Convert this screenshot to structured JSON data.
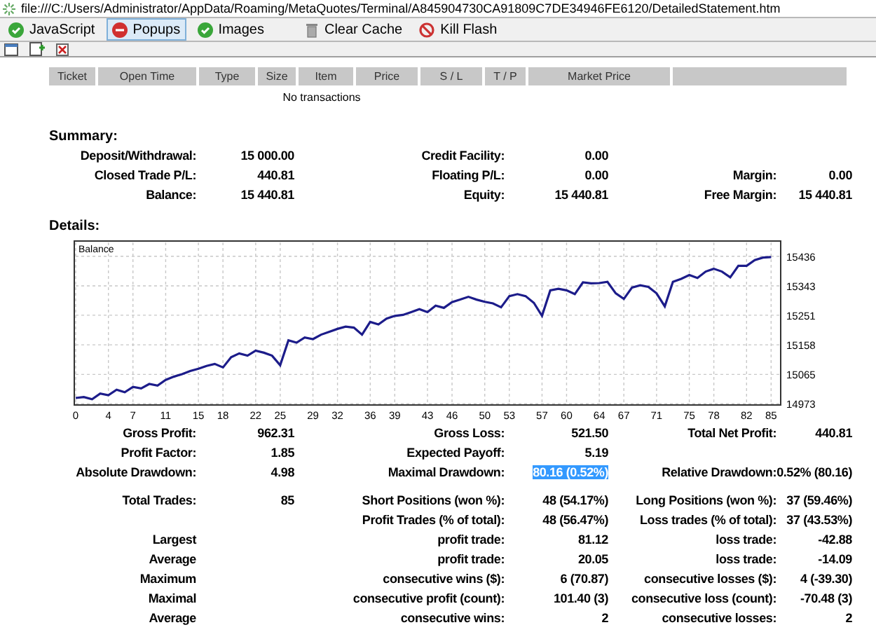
{
  "address_bar": {
    "url": "file:///C:/Users/Administrator/AppData/Roaming/MetaQuotes/Terminal/A845904730CA91809C7DE34946FE6120/DetailedStatement.htm"
  },
  "toolbar": [
    {
      "label": "JavaScript",
      "kind": "allowed",
      "selected": false
    },
    {
      "label": "Popups",
      "kind": "blocked",
      "selected": true
    },
    {
      "label": "Images",
      "kind": "allowed",
      "selected": false
    },
    {
      "label": "Clear Cache",
      "kind": "trash",
      "selected": false
    },
    {
      "label": "Kill Flash",
      "kind": "flash",
      "selected": false
    }
  ],
  "working_orders": {
    "columns": [
      "Ticket",
      "Open Time",
      "Type",
      "Size",
      "Item",
      "Price",
      "S / L",
      "T / P",
      "Market Price"
    ],
    "empty_text": "No transactions"
  },
  "summary": {
    "title": "Summary:",
    "groups": [
      [
        {
          "left": {
            "label": "Deposit/Withdrawal:",
            "value": "15 000.00"
          },
          "middle": {
            "label": "Credit Facility:",
            "value": "0.00"
          }
        },
        {
          "left": {
            "label": "Closed Trade P/L:",
            "value": "440.81"
          },
          "middle": {
            "label": "Floating P/L:",
            "value": "0.00"
          },
          "right": {
            "label": "Margin:",
            "value": "0.00"
          }
        },
        {
          "left": {
            "label": "Balance:",
            "value": "15 440.81"
          },
          "middle": {
            "label": "Equity:",
            "value": "15 440.81"
          },
          "right": {
            "label": "Free Margin:",
            "value": "15 440.81"
          }
        }
      ]
    ]
  },
  "details": {
    "title": "Details:",
    "chart_data": {
      "type": "line",
      "grid": true,
      "x": [
        0,
        1,
        2,
        3,
        4,
        5,
        6,
        7,
        8,
        9,
        10,
        11,
        12,
        13,
        14,
        15,
        16,
        17,
        18,
        19,
        20,
        21,
        22,
        23,
        24,
        25,
        26,
        27,
        28,
        29,
        30,
        31,
        32,
        33,
        34,
        35,
        36,
        37,
        38,
        39,
        40,
        41,
        42,
        43,
        44,
        45,
        46,
        47,
        48,
        49,
        50,
        51,
        52,
        53,
        54,
        55,
        56,
        57,
        58,
        59,
        60,
        61,
        62,
        63,
        64,
        65,
        66,
        67,
        68,
        69,
        70,
        71,
        72,
        73,
        74,
        75,
        76,
        77,
        78,
        79,
        80,
        81,
        82,
        83,
        84,
        85
      ],
      "series": [
        {
          "name": "Balance",
          "color": "#1c1c8a",
          "values": [
            14991,
            14994,
            14987,
            15005,
            15000,
            15017,
            15009,
            15026,
            15021,
            15035,
            15030,
            15048,
            15058,
            15066,
            15076,
            15083,
            15092,
            15098,
            15087,
            15119,
            15131,
            15124,
            15140,
            15133,
            15124,
            15094,
            15172,
            15165,
            15181,
            15176,
            15190,
            15199,
            15208,
            15215,
            15212,
            15190,
            15230,
            15222,
            15240,
            15249,
            15252,
            15261,
            15270,
            15261,
            15281,
            15274,
            15292,
            15300,
            15309,
            15300,
            15293,
            15288,
            15276,
            15311,
            15317,
            15311,
            15290,
            15249,
            15329,
            15334,
            15329,
            15317,
            15354,
            15351,
            15352,
            15356,
            15320,
            15302,
            15338,
            15345,
            15340,
            15320,
            15279,
            15356,
            15365,
            15377,
            15368,
            15388,
            15397,
            15388,
            15370,
            15406,
            15406,
            15424,
            15432,
            15434
          ]
        }
      ],
      "xlim": [
        0,
        86
      ],
      "ylim": [
        14969,
        15484
      ],
      "xticks": [
        0,
        4,
        7,
        11,
        15,
        18,
        22,
        25,
        29,
        32,
        36,
        39,
        43,
        46,
        50,
        53,
        57,
        60,
        64,
        67,
        71,
        75,
        78,
        82,
        85
      ],
      "yticks": [
        14973,
        15065,
        15158,
        15251,
        15343,
        15436
      ]
    },
    "groups": [
      [
        {
          "left": {
            "label": "Gross Profit:",
            "value": "962.31"
          },
          "middle": {
            "label": "Gross Loss:",
            "value": "521.50"
          },
          "right": {
            "label": "Total Net Profit:",
            "value": "440.81"
          }
        },
        {
          "left": {
            "label": "Profit Factor:",
            "value": "1.85"
          },
          "middle": {
            "label": "Expected Payoff:",
            "value": "5.19"
          }
        },
        {
          "left": {
            "label": "Absolute Drawdown:",
            "value": "4.98"
          },
          "middle": {
            "label": "Maximal Drawdown:",
            "value": "80.16 (0.52%)",
            "highlighted": true
          },
          "right": {
            "label": "Relative Drawdown:",
            "value": "0.52% (80.16)"
          }
        }
      ],
      [
        {
          "left": {
            "label": "Total Trades:",
            "value": "85"
          },
          "middle": {
            "label": "Short Positions (won %):",
            "value": "48 (54.17%)"
          },
          "right": {
            "label": "Long Positions (won %):",
            "value": "37 (59.46%)"
          }
        },
        {
          "middle": {
            "label": "Profit Trades (% of total):",
            "value": "48 (56.47%)"
          },
          "right": {
            "label": "Loss trades (% of total):",
            "value": "37 (43.53%)"
          }
        },
        {
          "left": {
            "label": "Largest"
          },
          "middle": {
            "label": "profit trade:",
            "value": "81.12"
          },
          "right": {
            "label": "loss trade:",
            "value": "-42.88"
          }
        },
        {
          "left": {
            "label": "Average"
          },
          "middle": {
            "label": "profit trade:",
            "value": "20.05"
          },
          "right": {
            "label": "loss trade:",
            "value": "-14.09"
          }
        },
        {
          "left": {
            "label": "Maximum"
          },
          "middle": {
            "label": "consecutive wins ($):",
            "value": "6 (70.87)"
          },
          "right": {
            "label": "consecutive losses ($):",
            "value": "4 (-39.30)"
          }
        },
        {
          "left": {
            "label": "Maximal"
          },
          "middle": {
            "label": "consecutive profit (count):",
            "value": "101.40 (3)"
          },
          "right": {
            "label": "consecutive loss (count):",
            "value": "-70.48 (3)"
          }
        },
        {
          "left": {
            "label": "Average"
          },
          "middle": {
            "label": "consecutive wins:",
            "value": "2"
          },
          "right": {
            "label": "consecutive losses:",
            "value": "2"
          }
        }
      ]
    ]
  }
}
